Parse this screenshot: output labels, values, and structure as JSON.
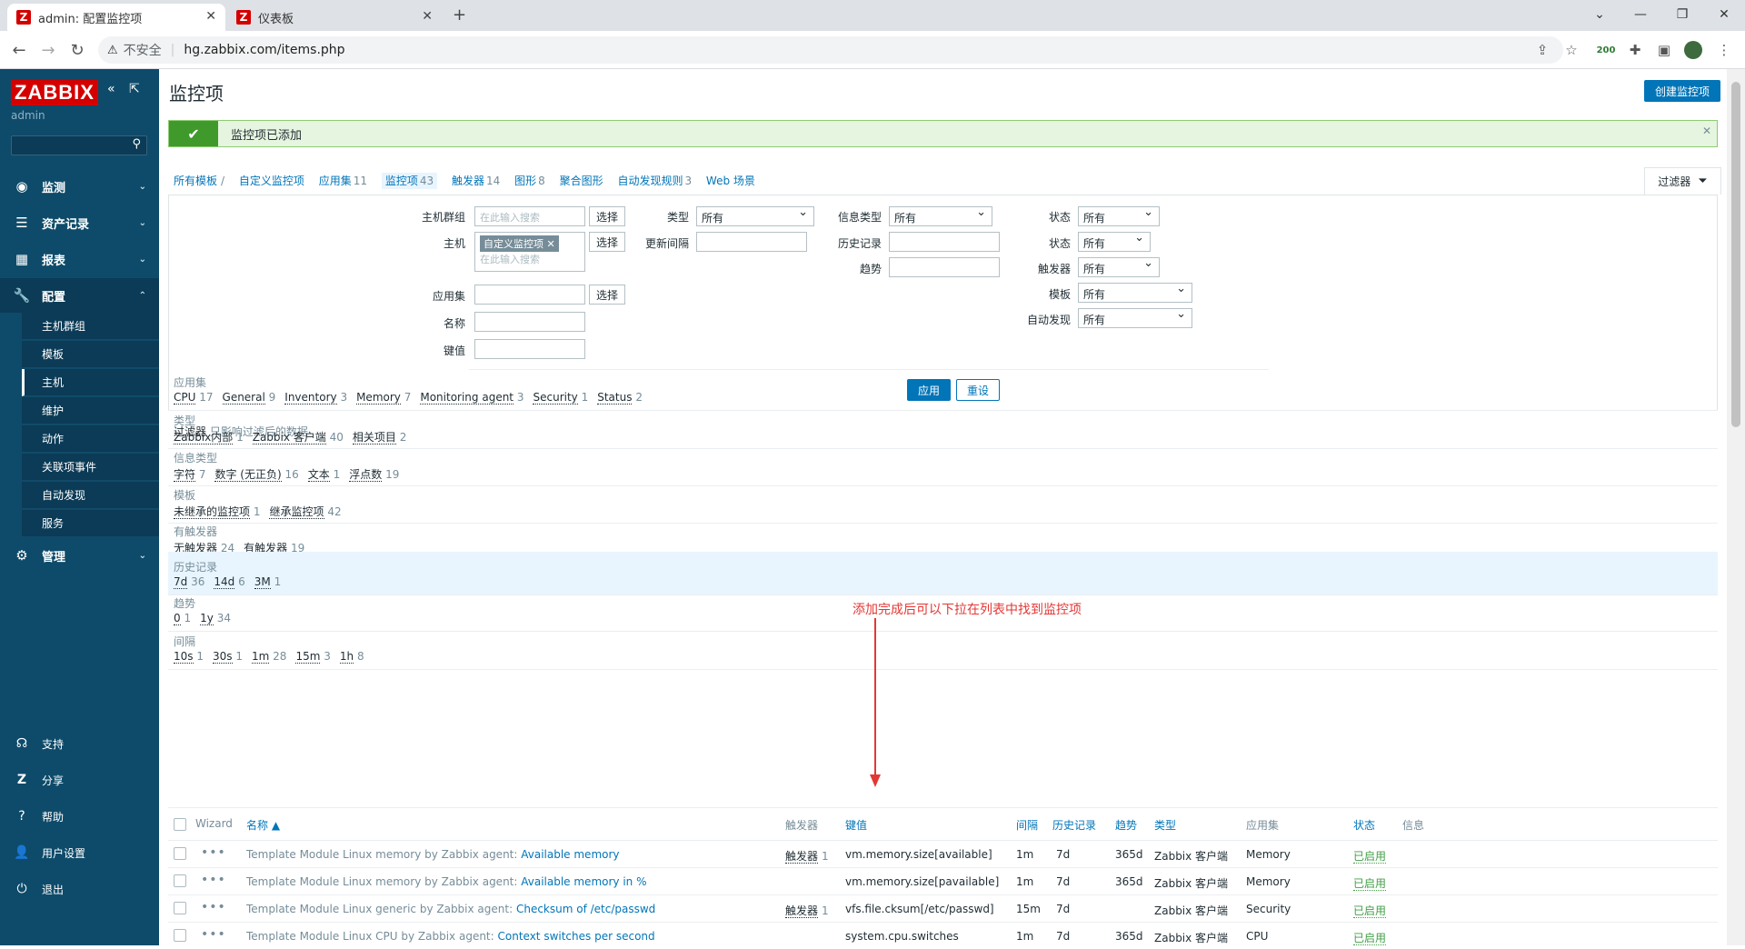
{
  "browser": {
    "tabs": [
      {
        "title": "admin: 配置监控项",
        "active": true
      },
      {
        "title": "仪表板",
        "active": false
      }
    ],
    "insecure_label": "不安全",
    "url": "hg.zabbix.com/items.php",
    "ext_badge": "200"
  },
  "sidebar": {
    "brand": "ZABBIX",
    "user": "admin",
    "menu": [
      {
        "label": "监测",
        "icon": "eye-icon"
      },
      {
        "label": "资产记录",
        "icon": "list-icon"
      },
      {
        "label": "报表",
        "icon": "chart-icon"
      },
      {
        "label": "配置",
        "icon": "wrench-icon"
      },
      {
        "label": "管理",
        "icon": "gear-icon"
      }
    ],
    "config_sub": [
      "主机群组",
      "模板",
      "主机",
      "维护",
      "动作",
      "关联项事件",
      "自动发现",
      "服务"
    ],
    "bottom": [
      {
        "label": "支持",
        "icon": "headset-icon"
      },
      {
        "label": "分享",
        "icon": "share-icon"
      },
      {
        "label": "帮助",
        "icon": "help-icon"
      },
      {
        "label": "用户设置",
        "icon": "user-icon"
      },
      {
        "label": "退出",
        "icon": "power-icon"
      }
    ]
  },
  "page": {
    "title": "监控项",
    "create_button": "创建监控项",
    "message": "监控项已添加"
  },
  "crumbs": [
    {
      "label": "所有模板",
      "count": ""
    },
    {
      "label": "自定义监控项",
      "count": ""
    },
    {
      "label": "应用集",
      "count": "11"
    },
    {
      "label": "监控项",
      "count": "43"
    },
    {
      "label": "触发器",
      "count": "14"
    },
    {
      "label": "图形",
      "count": "8"
    },
    {
      "label": "聚合图形",
      "count": ""
    },
    {
      "label": "自动发现规则",
      "count": "3"
    },
    {
      "label": "Web 场景",
      "count": ""
    }
  ],
  "filter": {
    "tab_label": "过滤器",
    "host_group_label": "主机群组",
    "host_label": "主机",
    "app_label": "应用集",
    "name_label": "名称",
    "key_label": "键值",
    "placeholder": "在此输入搜索",
    "select_btn": "选择",
    "host_tag": "自定义监控项",
    "type_label": "类型",
    "type_value": "所有",
    "interval_label": "更新间隔",
    "info_type_label": "信息类型",
    "info_type_value": "所有",
    "history_label": "历史记录",
    "trends_label": "趋势",
    "status_label1": "状态",
    "status_value1": "所有",
    "status_label2": "状态",
    "status_value2": "所有",
    "triggers_label": "触发器",
    "triggers_value": "所有",
    "template_label": "模板",
    "template_value": "所有",
    "discovery_label": "自动发现",
    "discovery_value": "所有",
    "apply": "应用",
    "reset": "重设",
    "note_title": "过滤器",
    "note_sub": "只影响过滤后的数据"
  },
  "subfilters": [
    {
      "title": "应用集",
      "items": [
        [
          "CPU",
          "17"
        ],
        [
          "General",
          "9"
        ],
        [
          "Inventory",
          "3"
        ],
        [
          "Memory",
          "7"
        ],
        [
          "Monitoring agent",
          "3"
        ],
        [
          "Security",
          "1"
        ],
        [
          "Status",
          "2"
        ]
      ]
    },
    {
      "title": "类型",
      "items": [
        [
          "Zabbix内部",
          "1"
        ],
        [
          "Zabbix 客户端",
          "40"
        ],
        [
          "相关项目",
          "2"
        ]
      ]
    },
    {
      "title": "信息类型",
      "items": [
        [
          "字符",
          "7"
        ],
        [
          "数字 (无正负)",
          "16"
        ],
        [
          "文本",
          "1"
        ],
        [
          "浮点数",
          "19"
        ]
      ]
    },
    {
      "title": "模板",
      "items": [
        [
          "未继承的监控项",
          "1"
        ],
        [
          "继承监控项",
          "42"
        ]
      ]
    },
    {
      "title": "有触发器",
      "items": [
        [
          "无触发器",
          "24"
        ],
        [
          "有触发器",
          "19"
        ]
      ]
    },
    {
      "title": "历史记录",
      "items": [
        [
          "7d",
          "36"
        ],
        [
          "14d",
          "6"
        ],
        [
          "3M",
          "1"
        ]
      ]
    },
    {
      "title": "趋势",
      "items": [
        [
          "0",
          "1"
        ],
        [
          "1y",
          "34"
        ]
      ]
    },
    {
      "title": "间隔",
      "items": [
        [
          "10s",
          "1"
        ],
        [
          "30s",
          "1"
        ],
        [
          "1m",
          "28"
        ],
        [
          "15m",
          "3"
        ],
        [
          "1h",
          "8"
        ]
      ]
    }
  ],
  "annotation": "添加完成后可以下拉在列表中找到监控项",
  "table": {
    "headers": {
      "wizard": "Wizard",
      "name": "名称 ▲",
      "triggers": "触发器",
      "key": "键值",
      "interval": "间隔",
      "history": "历史记录",
      "trends": "趋势",
      "type": "类型",
      "app": "应用集",
      "status": "状态",
      "info": "信息"
    },
    "rows": [
      {
        "prefix": "Template Module Linux memory by Zabbix agent: ",
        "name": "Available memory",
        "trig": "触发器",
        "trig_n": "1",
        "key": "vm.memory.size[available]",
        "interval": "1m",
        "history": "7d",
        "trends": "365d",
        "type": "Zabbix 客户端",
        "app": "Memory",
        "status": "已启用"
      },
      {
        "prefix": "Template Module Linux memory by Zabbix agent: ",
        "name": "Available memory in %",
        "trig": "",
        "trig_n": "",
        "key": "vm.memory.size[pavailable]",
        "interval": "1m",
        "history": "7d",
        "trends": "365d",
        "type": "Zabbix 客户端",
        "app": "Memory",
        "status": "已启用"
      },
      {
        "prefix": "Template Module Linux generic by Zabbix agent: ",
        "name": "Checksum of /etc/passwd",
        "trig": "触发器",
        "trig_n": "1",
        "key": "vfs.file.cksum[/etc/passwd]",
        "interval": "15m",
        "history": "7d",
        "trends": "",
        "type": "Zabbix 客户端",
        "app": "Security",
        "status": "已启用"
      },
      {
        "prefix": "Template Module Linux CPU by Zabbix agent: ",
        "name": "Context switches per second",
        "trig": "",
        "trig_n": "",
        "key": "system.cpu.switches",
        "interval": "1m",
        "history": "7d",
        "trends": "365d",
        "type": "Zabbix 客户端",
        "app": "CPU",
        "status": "已启用"
      }
    ]
  }
}
